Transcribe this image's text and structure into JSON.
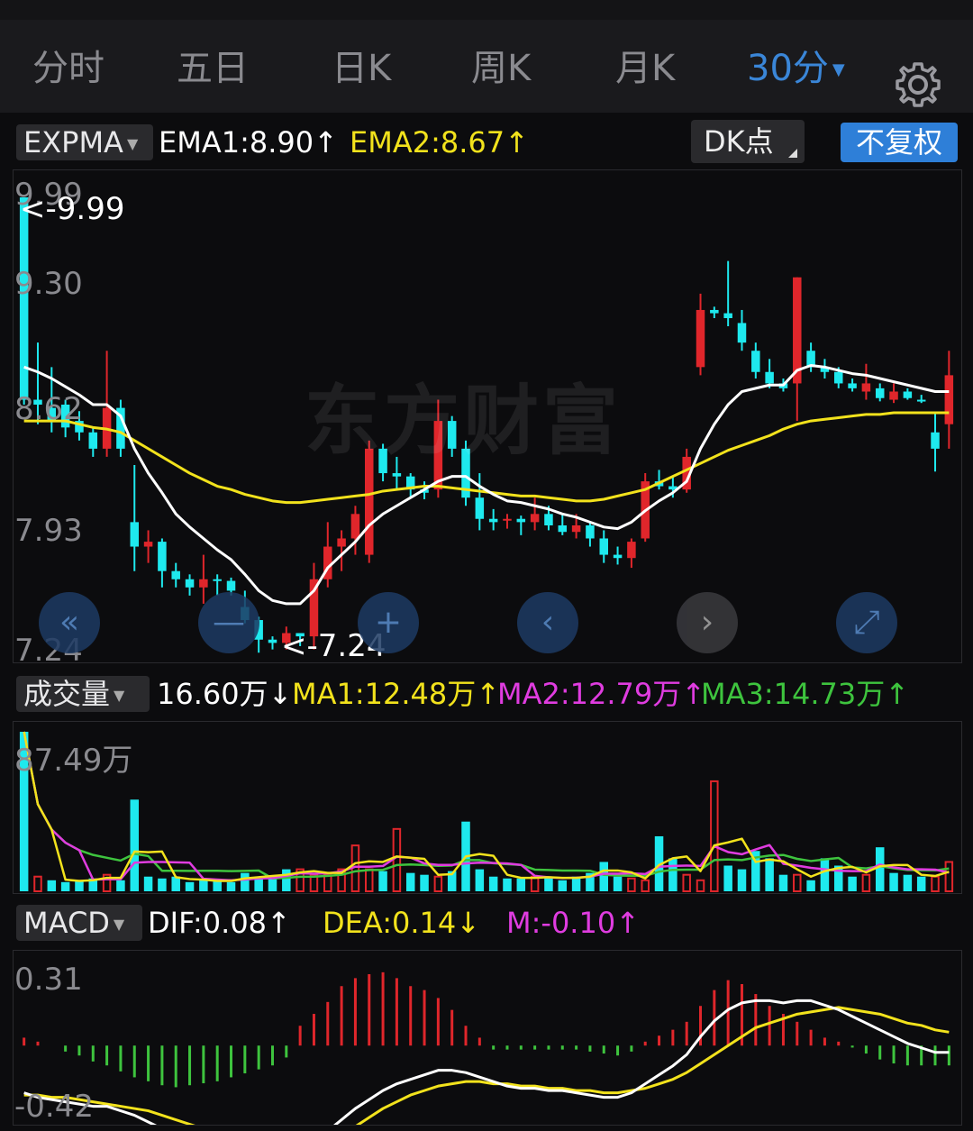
{
  "tabs": [
    {
      "label": "分时",
      "active": false
    },
    {
      "label": "五日",
      "active": false
    },
    {
      "label": "日K",
      "active": false
    },
    {
      "label": "周K",
      "active": false
    },
    {
      "label": "月K",
      "active": false
    },
    {
      "label": "30分",
      "active": true
    }
  ],
  "period_dropdown_icon": "caret-down-icon",
  "settings_icon": "gear-icon",
  "main": {
    "indicator_name": "EXPMA",
    "ema1": "EMA1:8.90",
    "ema1_arrow": "↑",
    "ema2": "EMA2:8.67",
    "ema2_arrow": "↑",
    "dk_label": "DK点",
    "fq_label": "不复权",
    "y_labels": [
      "9.99",
      "9.30",
      "8.62",
      "7.93",
      "7.24"
    ],
    "high_marker": "<-9.99",
    "low_marker": "<-7.24",
    "watermark": "东方财富"
  },
  "nav_buttons": [
    {
      "name": "fast-back-button",
      "icon": "double-chevron-left-icon",
      "glyph": "«"
    },
    {
      "name": "zoom-out-button",
      "icon": "minus-icon",
      "glyph": "—"
    },
    {
      "name": "zoom-in-button",
      "icon": "plus-icon",
      "glyph": "+"
    },
    {
      "name": "prev-button",
      "icon": "chevron-left-icon",
      "glyph": "‹"
    },
    {
      "name": "next-button",
      "icon": "chevron-right-icon",
      "glyph": "›"
    },
    {
      "name": "fullscreen-button",
      "icon": "expand-icon",
      "glyph": "⤢"
    }
  ],
  "volume": {
    "indicator_name": "成交量",
    "current": "16.60万",
    "current_arrow": "↓",
    "ma1": "MA1:12.48万",
    "ma1_arrow": "↑",
    "ma2": "MA2:12.79万",
    "ma2_arrow": "↑",
    "ma3": "MA3:14.73万",
    "ma3_arrow": "↑",
    "y_max_label": "87.49万"
  },
  "macd": {
    "indicator_name": "MACD",
    "dif": "DIF:0.08",
    "dif_arrow": "↑",
    "dea": "DEA:0.14",
    "dea_arrow": "↓",
    "m": "M:-0.10",
    "m_arrow": "↑",
    "y_top_label": "0.31",
    "y_bottom_label": "-0.42"
  },
  "colors": {
    "up": "#e0262b",
    "down": "#1ee9ee",
    "ema1": "#ffffff",
    "ema2": "#f2e21c",
    "ma2": "#e03ce0",
    "ma3": "#3ec43e",
    "accent": "#3a86d8"
  },
  "chart_data": {
    "type": "candlestick",
    "price_range": [
      7.24,
      9.99
    ],
    "candles_ohlc": [
      [
        9.99,
        9.99,
        8.72,
        8.75
      ],
      [
        8.75,
        9.1,
        8.6,
        8.72
      ],
      [
        8.7,
        8.95,
        8.55,
        8.62
      ],
      [
        8.72,
        8.75,
        8.52,
        8.58
      ],
      [
        8.62,
        8.68,
        8.5,
        8.55
      ],
      [
        8.55,
        8.58,
        8.4,
        8.45
      ],
      [
        8.45,
        9.05,
        8.4,
        8.7
      ],
      [
        8.7,
        8.75,
        8.4,
        8.45
      ],
      [
        8.0,
        8.35,
        7.7,
        7.85
      ],
      [
        7.85,
        7.95,
        7.75,
        7.88
      ],
      [
        7.88,
        7.9,
        7.6,
        7.7
      ],
      [
        7.7,
        7.75,
        7.6,
        7.65
      ],
      [
        7.65,
        7.68,
        7.55,
        7.6
      ],
      [
        7.6,
        7.8,
        7.5,
        7.65
      ],
      [
        7.65,
        7.68,
        7.55,
        7.64
      ],
      [
        7.64,
        7.66,
        7.55,
        7.58
      ],
      [
        7.48,
        7.58,
        7.38,
        7.4
      ],
      [
        7.4,
        7.42,
        7.2,
        7.28
      ],
      [
        7.28,
        7.3,
        7.22,
        7.26
      ],
      [
        7.26,
        7.36,
        7.22,
        7.32
      ],
      [
        7.32,
        7.32,
        7.24,
        7.3
      ],
      [
        7.3,
        7.75,
        7.22,
        7.65
      ],
      [
        7.65,
        8.0,
        7.6,
        7.85
      ],
      [
        7.85,
        7.95,
        7.7,
        7.9
      ],
      [
        7.9,
        8.1,
        7.8,
        8.05
      ],
      [
        7.8,
        8.5,
        7.75,
        8.45
      ],
      [
        8.45,
        8.48,
        8.25,
        8.3
      ],
      [
        8.3,
        8.4,
        8.2,
        8.28
      ],
      [
        8.28,
        8.3,
        8.15,
        8.2
      ],
      [
        8.2,
        8.25,
        8.14,
        8.18
      ],
      [
        8.2,
        8.75,
        8.15,
        8.62
      ],
      [
        8.62,
        8.65,
        8.4,
        8.45
      ],
      [
        8.45,
        8.5,
        8.1,
        8.15
      ],
      [
        8.15,
        8.3,
        7.95,
        8.02
      ],
      [
        8.02,
        8.08,
        7.95,
        8.0
      ],
      [
        8.02,
        8.05,
        7.96,
        8.02
      ],
      [
        8.02,
        8.04,
        7.92,
        8.0
      ],
      [
        8.0,
        8.15,
        7.95,
        8.05
      ],
      [
        8.05,
        8.1,
        7.95,
        7.98
      ],
      [
        7.98,
        8.05,
        7.92,
        7.94
      ],
      [
        7.94,
        8.05,
        7.9,
        7.98
      ],
      [
        7.98,
        8.0,
        7.85,
        7.9
      ],
      [
        7.9,
        7.95,
        7.75,
        7.8
      ],
      [
        7.8,
        7.85,
        7.74,
        7.78
      ],
      [
        7.78,
        7.9,
        7.72,
        7.88
      ],
      [
        7.9,
        8.3,
        7.88,
        8.25
      ],
      [
        8.25,
        8.32,
        8.2,
        8.22
      ],
      [
        8.22,
        8.28,
        8.15,
        8.2
      ],
      [
        8.2,
        8.45,
        8.18,
        8.4
      ],
      [
        8.95,
        9.4,
        8.9,
        9.3
      ],
      [
        9.3,
        9.32,
        9.25,
        9.28
      ],
      [
        9.28,
        9.6,
        9.2,
        9.25
      ],
      [
        9.22,
        9.3,
        9.05,
        9.1
      ],
      [
        9.05,
        9.1,
        8.88,
        8.92
      ],
      [
        8.92,
        9.0,
        8.82,
        8.85
      ],
      [
        8.85,
        8.88,
        8.8,
        8.82
      ],
      [
        8.85,
        9.5,
        8.62,
        9.5
      ],
      [
        9.05,
        9.1,
        8.92,
        8.95
      ],
      [
        8.95,
        9.0,
        8.88,
        8.92
      ],
      [
        8.92,
        8.95,
        8.82,
        8.85
      ],
      [
        8.85,
        8.88,
        8.8,
        8.82
      ],
      [
        8.8,
        8.97,
        8.75,
        8.85
      ],
      [
        8.82,
        8.85,
        8.74,
        8.76
      ],
      [
        8.75,
        8.85,
        8.73,
        8.8
      ],
      [
        8.8,
        8.82,
        8.75,
        8.76
      ],
      [
        8.75,
        8.78,
        8.73,
        8.74
      ],
      [
        8.55,
        8.67,
        8.31,
        8.45
      ],
      [
        8.6,
        9.05,
        8.45,
        8.9
      ]
    ],
    "ema1_series": [
      8.95,
      8.92,
      8.88,
      8.83,
      8.78,
      8.72,
      8.72,
      8.65,
      8.45,
      8.3,
      8.18,
      8.05,
      7.97,
      7.9,
      7.83,
      7.77,
      7.68,
      7.58,
      7.52,
      7.5,
      7.5,
      7.58,
      7.72,
      7.8,
      7.88,
      7.98,
      8.05,
      8.1,
      8.15,
      8.2,
      8.25,
      8.28,
      8.28,
      8.22,
      8.17,
      8.13,
      8.12,
      8.1,
      8.08,
      8.05,
      8.03,
      8.0,
      7.97,
      7.96,
      8.0,
      8.07,
      8.13,
      8.18,
      8.25,
      8.45,
      8.6,
      8.72,
      8.8,
      8.82,
      8.84,
      8.84,
      8.93,
      8.96,
      8.95,
      8.93,
      8.91,
      8.9,
      8.88,
      8.86,
      8.84,
      8.82,
      8.8,
      8.8
    ],
    "ema2_series": [
      8.62,
      8.62,
      8.62,
      8.62,
      8.6,
      8.58,
      8.57,
      8.55,
      8.5,
      8.45,
      8.4,
      8.35,
      8.3,
      8.26,
      8.22,
      8.2,
      8.17,
      8.15,
      8.13,
      8.12,
      8.12,
      8.13,
      8.14,
      8.15,
      8.16,
      8.17,
      8.19,
      8.2,
      8.21,
      8.22,
      8.22,
      8.21,
      8.2,
      8.19,
      8.18,
      8.17,
      8.16,
      8.16,
      8.15,
      8.14,
      8.13,
      8.13,
      8.14,
      8.16,
      8.18,
      8.2,
      8.24,
      8.28,
      8.32,
      8.36,
      8.4,
      8.44,
      8.47,
      8.5,
      8.53,
      8.57,
      8.6,
      8.62,
      8.63,
      8.64,
      8.65,
      8.66,
      8.66,
      8.67,
      8.67,
      8.67,
      8.67,
      8.67
    ],
    "volume_max": 87.49,
    "volume_series": [
      87,
      8,
      6,
      5,
      6,
      7,
      9,
      6,
      50,
      8,
      7,
      8,
      5,
      6,
      6,
      5,
      10,
      8,
      7,
      12,
      12,
      9,
      9,
      12,
      25,
      12,
      11,
      34,
      10,
      9,
      8,
      11,
      38,
      12,
      8,
      7,
      7,
      8,
      8,
      6,
      8,
      10,
      16,
      8,
      7,
      6,
      30,
      18,
      9,
      6,
      60,
      14,
      12,
      22,
      18,
      9,
      9,
      6,
      18,
      14,
      8,
      9,
      24,
      10,
      9,
      8,
      8,
      16
    ],
    "volume_up": [
      false,
      true,
      false,
      false,
      false,
      false,
      true,
      false,
      false,
      false,
      false,
      false,
      false,
      false,
      false,
      false,
      false,
      false,
      false,
      false,
      true,
      true,
      true,
      true,
      true,
      true,
      false,
      true,
      false,
      false,
      true,
      false,
      false,
      false,
      false,
      false,
      false,
      true,
      false,
      false,
      false,
      false,
      false,
      false,
      true,
      true,
      false,
      false,
      true,
      true,
      true,
      false,
      false,
      false,
      false,
      false,
      true,
      false,
      false,
      false,
      false,
      true,
      false,
      false,
      false,
      false,
      true,
      true
    ],
    "macd_range": [
      -0.42,
      0.31
    ],
    "dif_series": [
      -0.25,
      -0.27,
      -0.28,
      -0.29,
      -0.3,
      -0.31,
      -0.31,
      -0.33,
      -0.35,
      -0.38,
      -0.41,
      -0.43,
      -0.44,
      -0.45,
      -0.46,
      -0.47,
      -0.49,
      -0.5,
      -0.51,
      -0.52,
      -0.51,
      -0.47,
      -0.42,
      -0.37,
      -0.32,
      -0.28,
      -0.24,
      -0.21,
      -0.19,
      -0.17,
      -0.15,
      -0.15,
      -0.16,
      -0.18,
      -0.2,
      -0.22,
      -0.23,
      -0.23,
      -0.24,
      -0.24,
      -0.25,
      -0.26,
      -0.27,
      -0.27,
      -0.25,
      -0.21,
      -0.17,
      -0.13,
      -0.08,
      0.0,
      0.07,
      0.12,
      0.15,
      0.16,
      0.16,
      0.15,
      0.16,
      0.16,
      0.14,
      0.12,
      0.09,
      0.06,
      0.03,
      0.0,
      -0.03,
      -0.05,
      -0.07,
      -0.07
    ],
    "dea_series": [
      -0.26,
      -0.26,
      -0.27,
      -0.27,
      -0.28,
      -0.29,
      -0.3,
      -0.31,
      -0.32,
      -0.33,
      -0.35,
      -0.37,
      -0.39,
      -0.41,
      -0.43,
      -0.45,
      -0.47,
      -0.48,
      -0.49,
      -0.49,
      -0.49,
      -0.48,
      -0.46,
      -0.43,
      -0.4,
      -0.36,
      -0.32,
      -0.29,
      -0.26,
      -0.24,
      -0.22,
      -0.21,
      -0.2,
      -0.2,
      -0.21,
      -0.21,
      -0.22,
      -0.22,
      -0.23,
      -0.23,
      -0.24,
      -0.24,
      -0.25,
      -0.25,
      -0.24,
      -0.23,
      -0.21,
      -0.19,
      -0.16,
      -0.12,
      -0.08,
      -0.04,
      0.0,
      0.04,
      0.06,
      0.08,
      0.1,
      0.11,
      0.12,
      0.13,
      0.12,
      0.11,
      0.1,
      0.08,
      0.06,
      0.05,
      0.03,
      0.02
    ],
    "m_series": [
      0.04,
      0.02,
      0.0,
      -0.03,
      -0.05,
      -0.08,
      -0.1,
      -0.13,
      -0.16,
      -0.18,
      -0.2,
      -0.21,
      -0.2,
      -0.19,
      -0.18,
      -0.16,
      -0.14,
      -0.12,
      -0.1,
      -0.06,
      0.1,
      0.16,
      0.22,
      0.3,
      0.34,
      0.36,
      0.37,
      0.34,
      0.3,
      0.28,
      0.24,
      0.18,
      0.1,
      0.04,
      -0.02,
      -0.02,
      -0.02,
      -0.02,
      -0.02,
      -0.02,
      -0.02,
      -0.03,
      -0.04,
      -0.05,
      -0.03,
      0.02,
      0.05,
      0.08,
      0.12,
      0.2,
      0.28,
      0.33,
      0.31,
      0.26,
      0.2,
      0.16,
      0.12,
      0.08,
      0.04,
      0.02,
      -0.01,
      -0.04,
      -0.07,
      -0.09,
      -0.1,
      -0.1,
      -0.1,
      -0.1
    ]
  }
}
